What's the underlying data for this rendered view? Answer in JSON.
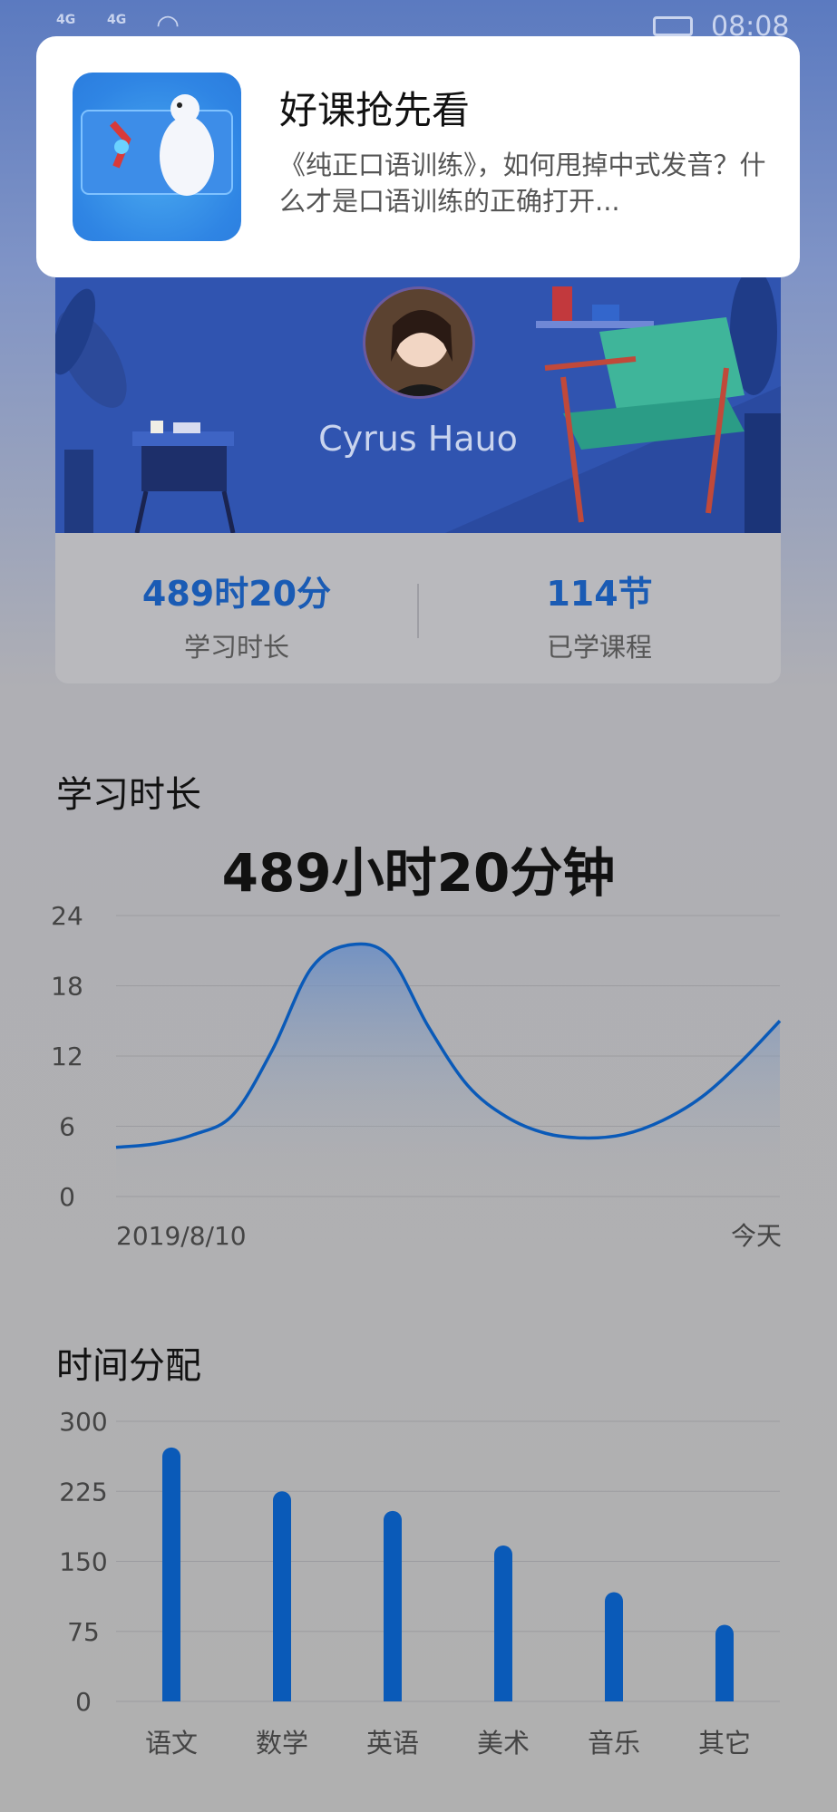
{
  "status_bar": {
    "signal1": "4G",
    "signal2": "4G",
    "time": "08:08"
  },
  "notification": {
    "title": "好课抢先看",
    "body": "《纯正口语训练》，如何甩掉中式发音？什么才是口语训练的正确打开..."
  },
  "profile": {
    "name": "Cyrus Hauo",
    "study_time_value": "489时20分",
    "study_time_label": "学习时长",
    "courses_value": "114节",
    "courses_label": "已学课程"
  },
  "study_section": {
    "title": "学习时长",
    "total": "489小时20分钟"
  },
  "distribution_section": {
    "title": "时间分配"
  },
  "colors": {
    "accent": "#1a5bb4",
    "bar": "#0a5ab8",
    "line": "#0a5ab8"
  },
  "chart_data": [
    {
      "type": "area",
      "ylim": [
        0,
        24
      ],
      "yticks": [
        "0",
        "6",
        "12",
        "18",
        "24"
      ],
      "x_start_label": "2019/8/10",
      "x_end_label": "今天",
      "series": [
        {
          "values": [
            4.2,
            4.5,
            5.3,
            7.0,
            12.5,
            19.5,
            21.5,
            20.5,
            14.5,
            9.5,
            6.8,
            5.4,
            5.0,
            5.3,
            6.5,
            8.5,
            11.5,
            15.0
          ]
        }
      ],
      "grid": true
    },
    {
      "type": "bar",
      "categories": [
        "语文",
        "数学",
        "英语",
        "美术",
        "音乐",
        "其它"
      ],
      "values": [
        272,
        225,
        204,
        167,
        117,
        82
      ],
      "ylim": [
        0,
        300
      ],
      "yticks": [
        "0",
        "75",
        "150",
        "225",
        "300"
      ],
      "grid": true
    }
  ]
}
